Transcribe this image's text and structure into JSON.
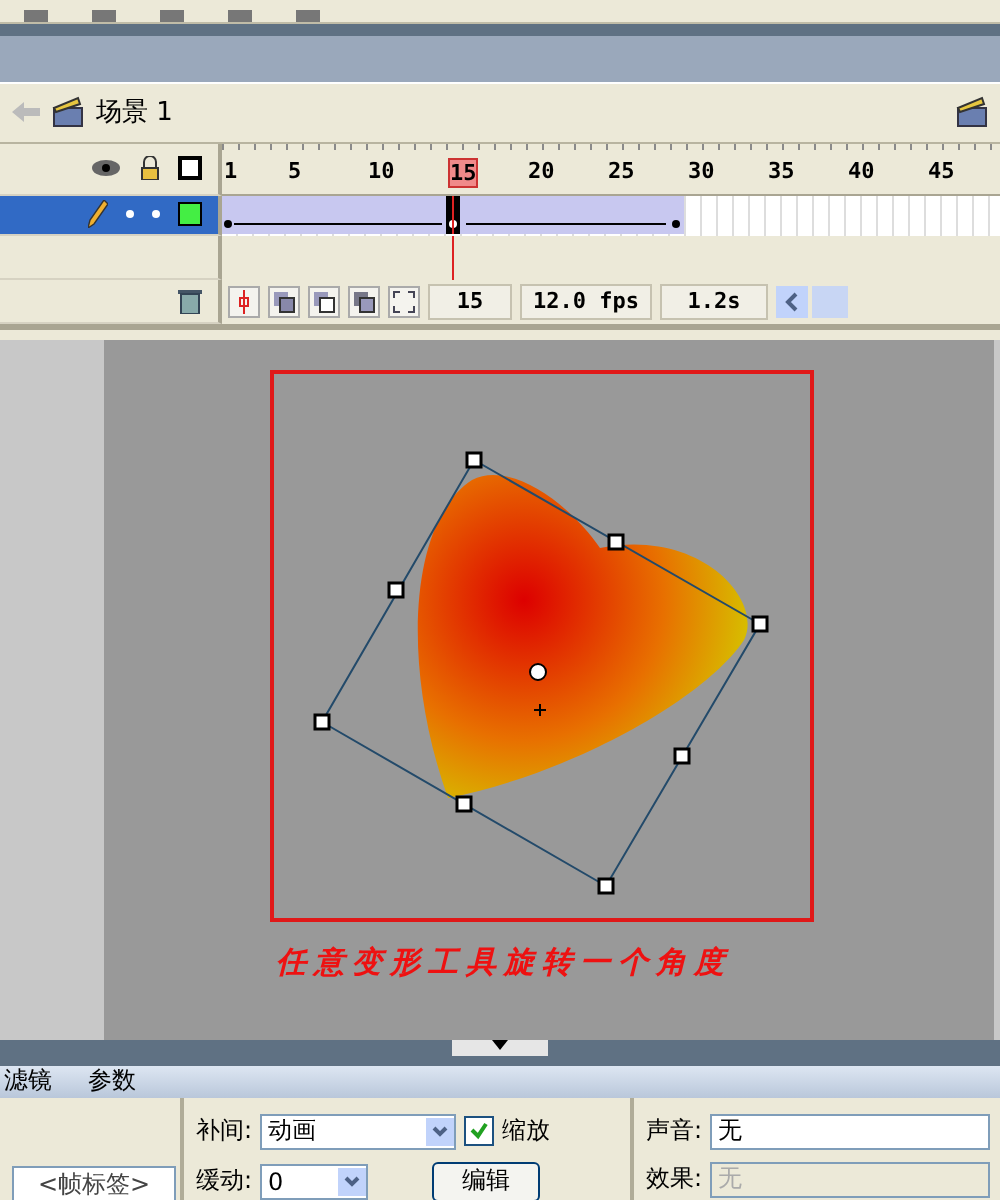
{
  "scene_bar": {
    "scene_name": "场景 1"
  },
  "timeline": {
    "ruler": [
      "1",
      "5",
      "10",
      "15",
      "20",
      "25",
      "30",
      "35",
      "40",
      "45"
    ],
    "layers": [
      {
        "selected": true,
        "locked": false,
        "visible": true
      }
    ],
    "status": {
      "frame": "15",
      "rate": "12.0 fps",
      "time": "1.2s"
    }
  },
  "stage": {
    "caption": "任意变形工具旋转一个角度"
  },
  "properties": {
    "tabs": [
      "滤镜",
      "参数"
    ],
    "frame_label": {
      "placeholder": "<帧标签>"
    },
    "tween": {
      "label": "补间:",
      "value": "动画"
    },
    "scale": {
      "label": "缩放",
      "checked": true
    },
    "ease": {
      "label": "缓动:",
      "value": "0"
    },
    "edit_button": "编辑",
    "sound": {
      "label": "声音:",
      "value": "无"
    },
    "effect": {
      "label": "效果:",
      "value": "无",
      "disabled": true
    }
  }
}
